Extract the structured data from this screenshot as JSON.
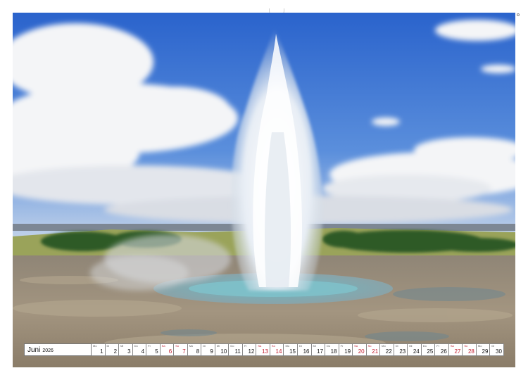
{
  "calendar": {
    "month": "Juni",
    "year": "2026",
    "days": [
      {
        "n": "1",
        "w": "Mo",
        "weekend": false
      },
      {
        "n": "2",
        "w": "Di",
        "weekend": false
      },
      {
        "n": "3",
        "w": "Mi",
        "weekend": false
      },
      {
        "n": "4",
        "w": "Do",
        "weekend": false
      },
      {
        "n": "5",
        "w": "Fr",
        "weekend": false
      },
      {
        "n": "6",
        "w": "Sa",
        "weekend": true
      },
      {
        "n": "7",
        "w": "So",
        "weekend": true
      },
      {
        "n": "8",
        "w": "Mo",
        "weekend": false
      },
      {
        "n": "9",
        "w": "Di",
        "weekend": false
      },
      {
        "n": "10",
        "w": "Mi",
        "weekend": false
      },
      {
        "n": "11",
        "w": "Do",
        "weekend": false
      },
      {
        "n": "12",
        "w": "Fr",
        "weekend": false
      },
      {
        "n": "13",
        "w": "Sa",
        "weekend": true
      },
      {
        "n": "14",
        "w": "So",
        "weekend": true
      },
      {
        "n": "15",
        "w": "Mo",
        "weekend": false
      },
      {
        "n": "16",
        "w": "Di",
        "weekend": false
      },
      {
        "n": "17",
        "w": "Mi",
        "weekend": false
      },
      {
        "n": "18",
        "w": "Do",
        "weekend": false
      },
      {
        "n": "19",
        "w": "Fr",
        "weekend": false
      },
      {
        "n": "20",
        "w": "Sa",
        "weekend": true
      },
      {
        "n": "21",
        "w": "So",
        "weekend": true
      },
      {
        "n": "22",
        "w": "Mo",
        "weekend": false
      },
      {
        "n": "23",
        "w": "Di",
        "weekend": false
      },
      {
        "n": "24",
        "w": "Mi",
        "weekend": false
      },
      {
        "n": "25",
        "w": "Do",
        "weekend": false
      },
      {
        "n": "26",
        "w": "Fr",
        "weekend": false
      },
      {
        "n": "27",
        "w": "Sa",
        "weekend": true
      },
      {
        "n": "28",
        "w": "So",
        "weekend": true
      },
      {
        "n": "29",
        "w": "Mo",
        "weekend": false
      },
      {
        "n": "30",
        "w": "Di",
        "weekend": false
      }
    ]
  },
  "colors": {
    "sky": "#2f6fd6",
    "weekend": "#c0192a",
    "water": "#7fb0bc"
  }
}
